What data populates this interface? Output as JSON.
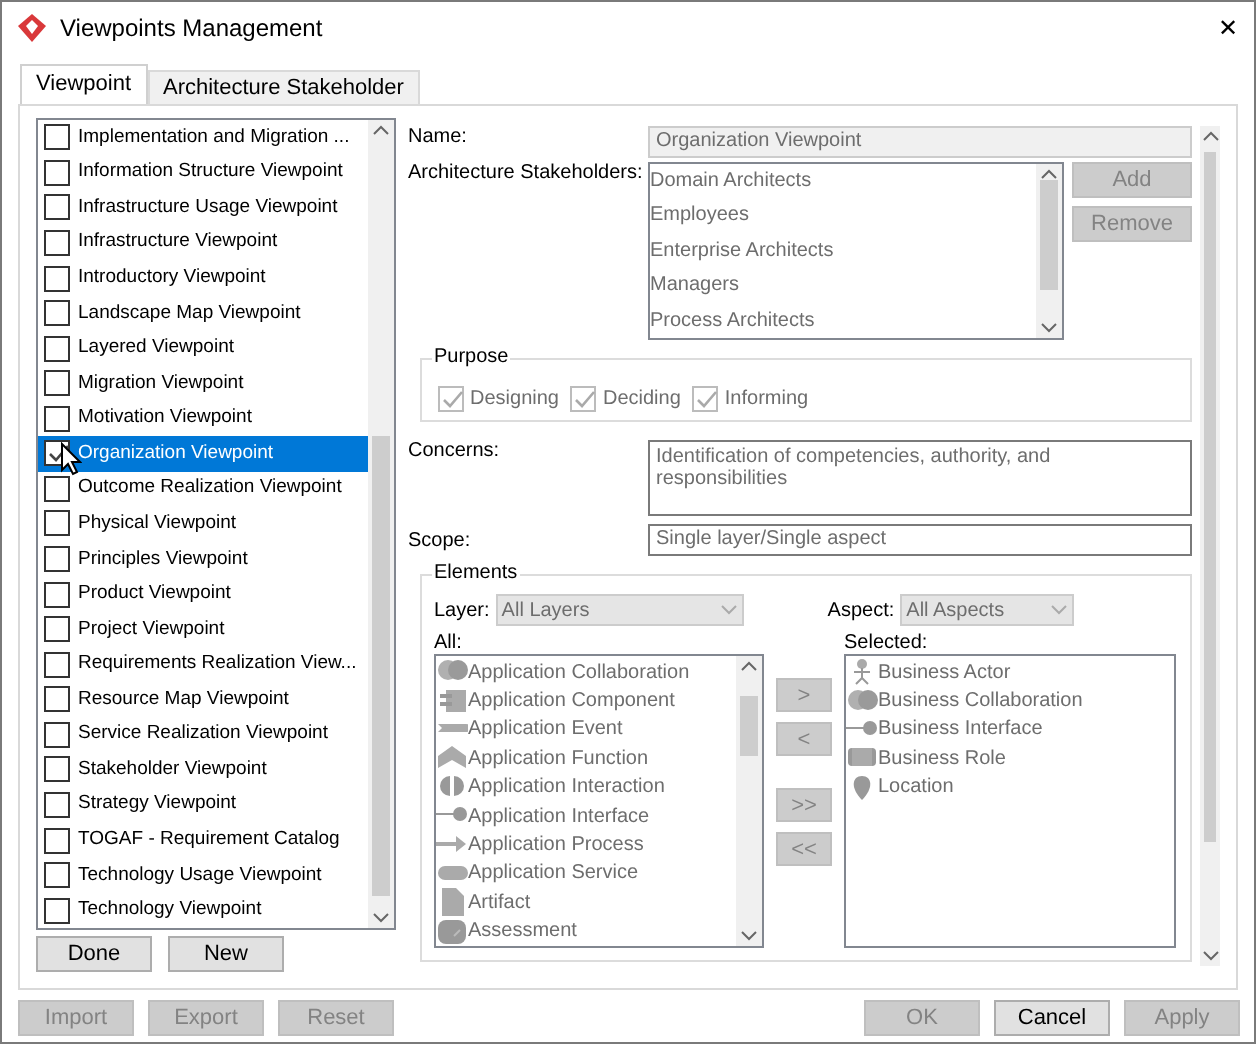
{
  "window": {
    "title": "Viewpoints Management",
    "close": "✕"
  },
  "tabs": [
    {
      "label": "Viewpoint",
      "selected": true
    },
    {
      "label": "Architecture Stakeholder",
      "selected": false
    }
  ],
  "viewpoints": [
    {
      "label": "Implementation and Migration ...",
      "checked": false,
      "selected": false
    },
    {
      "label": "Information Structure Viewpoint",
      "checked": false,
      "selected": false
    },
    {
      "label": "Infrastructure Usage Viewpoint",
      "checked": false,
      "selected": false
    },
    {
      "label": "Infrastructure Viewpoint",
      "checked": false,
      "selected": false
    },
    {
      "label": "Introductory Viewpoint",
      "checked": false,
      "selected": false
    },
    {
      "label": "Landscape Map Viewpoint",
      "checked": false,
      "selected": false
    },
    {
      "label": "Layered Viewpoint",
      "checked": false,
      "selected": false
    },
    {
      "label": "Migration Viewpoint",
      "checked": false,
      "selected": false
    },
    {
      "label": "Motivation Viewpoint",
      "checked": false,
      "selected": false
    },
    {
      "label": "Organization Viewpoint",
      "checked": true,
      "selected": true
    },
    {
      "label": "Outcome Realization Viewpoint",
      "checked": false,
      "selected": false
    },
    {
      "label": "Physical Viewpoint",
      "checked": false,
      "selected": false
    },
    {
      "label": "Principles Viewpoint",
      "checked": false,
      "selected": false
    },
    {
      "label": "Product Viewpoint",
      "checked": false,
      "selected": false
    },
    {
      "label": "Project Viewpoint",
      "checked": false,
      "selected": false
    },
    {
      "label": "Requirements Realization View...",
      "checked": false,
      "selected": false
    },
    {
      "label": "Resource Map Viewpoint",
      "checked": false,
      "selected": false
    },
    {
      "label": "Service Realization Viewpoint",
      "checked": false,
      "selected": false
    },
    {
      "label": "Stakeholder Viewpoint",
      "checked": false,
      "selected": false
    },
    {
      "label": "Strategy Viewpoint",
      "checked": false,
      "selected": false
    },
    {
      "label": "TOGAF - Requirement Catalog",
      "checked": false,
      "selected": false
    },
    {
      "label": "Technology Usage Viewpoint",
      "checked": false,
      "selected": false
    },
    {
      "label": "Technology Viewpoint",
      "checked": false,
      "selected": false
    }
  ],
  "list_buttons": [
    {
      "label": "Done",
      "disabled": false
    },
    {
      "label": "New",
      "disabled": false
    }
  ],
  "form": {
    "name": {
      "label": "Name:",
      "value": "Organization Viewpoint"
    },
    "stakeholders": {
      "label": "Architecture Stakeholders:",
      "items": [
        "Domain Architects",
        "Employees",
        "Enterprise Architects",
        "Managers",
        "Process Architects"
      ],
      "buttons": [
        {
          "label": "Add",
          "disabled": true
        },
        {
          "label": "Remove",
          "disabled": true
        }
      ]
    },
    "purpose": {
      "title": "Purpose",
      "options": [
        {
          "label": "Designing",
          "checked": true,
          "disabled": true
        },
        {
          "label": "Deciding",
          "checked": true,
          "disabled": true
        },
        {
          "label": "Informing",
          "checked": true,
          "disabled": true
        }
      ]
    },
    "concerns": {
      "label": "Concerns:",
      "value": "Identification of competencies, authority, and responsibilities"
    },
    "scope": {
      "label": "Scope:",
      "value": "Single layer/Single aspect"
    },
    "elements": {
      "title": "Elements",
      "layer": {
        "label": "Layer:",
        "value": "All Layers",
        "disabled": true
      },
      "aspect": {
        "label": "Aspect:",
        "value": "All Aspects",
        "disabled": true
      },
      "all": {
        "label": "All:",
        "items": [
          {
            "label": "Application Collaboration",
            "kind": "collaboration"
          },
          {
            "label": "Application Component",
            "kind": "component"
          },
          {
            "label": "Application Event",
            "kind": "event"
          },
          {
            "label": "Application Function",
            "kind": "function"
          },
          {
            "label": "Application Interaction",
            "kind": "interaction"
          },
          {
            "label": "Application Interface",
            "kind": "interface"
          },
          {
            "label": "Application Process",
            "kind": "process"
          },
          {
            "label": "Application Service",
            "kind": "service"
          },
          {
            "label": "Artifact",
            "kind": "artifact"
          },
          {
            "label": "Assessment",
            "kind": "assessment"
          }
        ]
      },
      "move_buttons": [
        {
          "label": ">",
          "disabled": true
        },
        {
          "label": "<",
          "disabled": true
        },
        {
          "label": ">>",
          "disabled": true
        },
        {
          "label": "<<",
          "disabled": true
        }
      ],
      "selected": {
        "label": "Selected:",
        "items": [
          {
            "label": "Business Actor",
            "kind": "actor"
          },
          {
            "label": "Business Collaboration",
            "kind": "collaboration"
          },
          {
            "label": "Business Interface",
            "kind": "interface"
          },
          {
            "label": "Business Role",
            "kind": "role"
          },
          {
            "label": "Location",
            "kind": "location"
          }
        ]
      }
    }
  },
  "footer_left": [
    {
      "label": "Import",
      "disabled": true
    },
    {
      "label": "Export",
      "disabled": true
    },
    {
      "label": "Reset",
      "disabled": true
    }
  ],
  "footer_right": [
    {
      "label": "OK",
      "disabled": true
    },
    {
      "label": "Cancel",
      "disabled": false
    },
    {
      "label": "Apply",
      "disabled": true
    }
  ]
}
